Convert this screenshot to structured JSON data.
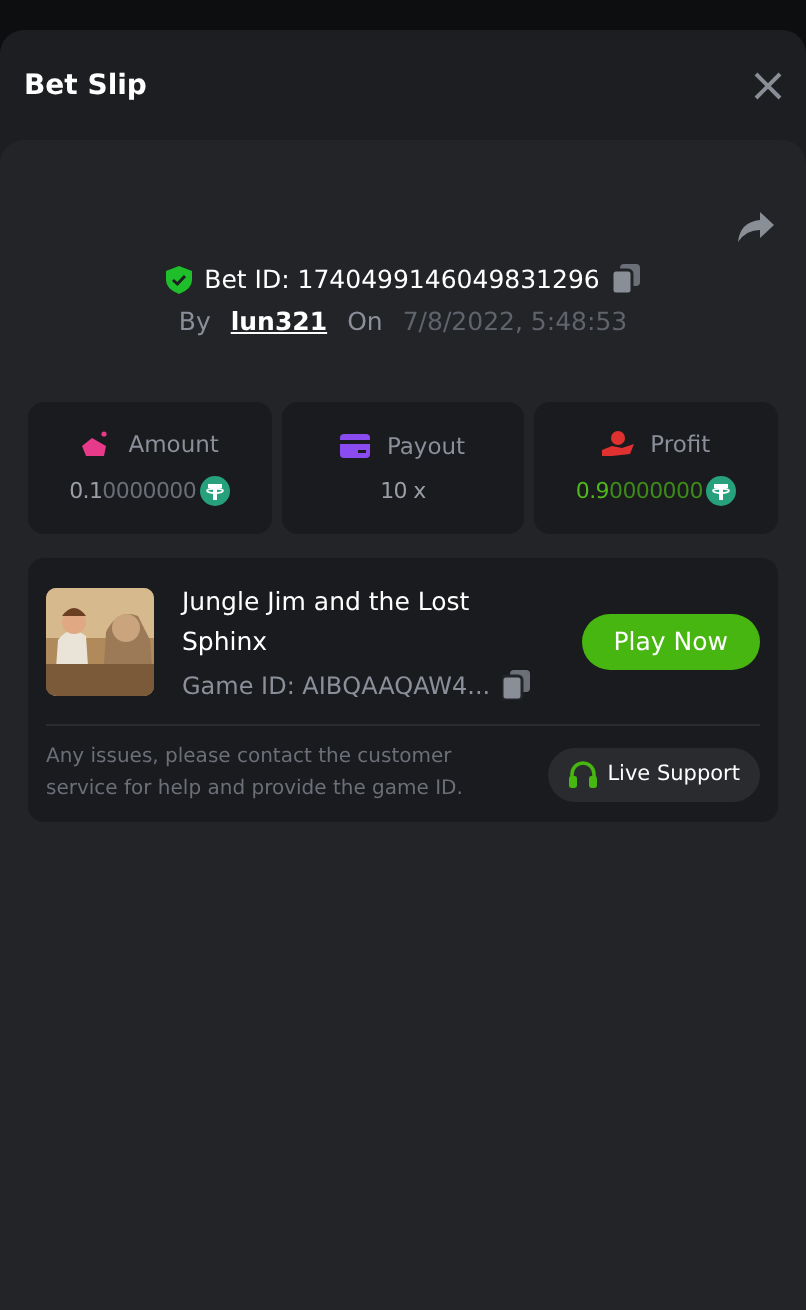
{
  "title": "Bet Slip",
  "bet": {
    "id_label": "Bet ID: 1740499146049831296",
    "by_label": "By",
    "user": "lun321",
    "on_label": "On",
    "date": "7/8/2022, 5:48:53"
  },
  "stats": [
    {
      "kind": "amount",
      "label": "Amount",
      "value_main": "0.1",
      "value_trail": "0000000"
    },
    {
      "kind": "payout",
      "label": "Payout",
      "value_main": "10 x"
    },
    {
      "kind": "profit",
      "label": "Profit",
      "value_main": "0.9",
      "value_trail": "0000000"
    }
  ],
  "game": {
    "title": "Jungle Jim and the Lost Sphinx",
    "game_id": "Game ID: AIBQAAQAW4...",
    "play_button": "Play Now"
  },
  "support": {
    "note": "Any issues, please contact the customer service for help and provide the game ID.",
    "button": "Live Support"
  }
}
